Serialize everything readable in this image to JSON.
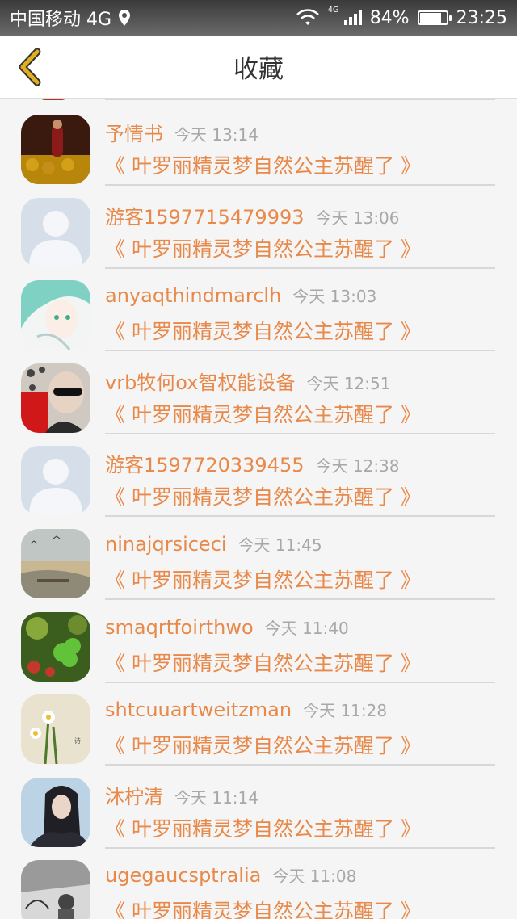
{
  "status_bar": {
    "carrier": "中国移动 4G",
    "network_small": "4G",
    "battery": "84%",
    "battery_level": 0.84,
    "time": "23:25"
  },
  "header": {
    "title": "收藏",
    "back_icon": "chevron-left-icon"
  },
  "colors": {
    "accent": "#e8894a",
    "back_icon": "#e0b020",
    "time_text": "#a8a8a8"
  },
  "items": [
    {
      "name": "予情书",
      "time": "今天 13:14",
      "subject": "《 叶罗丽精灵梦自然公主苏醒了 》",
      "avatar": "monk-photo"
    },
    {
      "name": "游客1597715479993",
      "time": "今天 13:06",
      "subject": "《 叶罗丽精灵梦自然公主苏醒了 》",
      "avatar": "default-person"
    },
    {
      "name": "anyaqthindmarclh",
      "time": "今天 13:03",
      "subject": "《 叶罗丽精灵梦自然公主苏醒了 》",
      "avatar": "anime-girl"
    },
    {
      "name": "vrb牧何ox智权能设备",
      "time": "今天 12:51",
      "subject": "《 叶罗丽精灵梦自然公主苏醒了 》",
      "avatar": "sunglasses-photo"
    },
    {
      "name": "游客1597720339455",
      "time": "今天 12:38",
      "subject": "《 叶罗丽精灵梦自然公主苏醒了 》",
      "avatar": "default-person"
    },
    {
      "name": "ninajqrsiceci",
      "time": "今天 11:45",
      "subject": "《 叶罗丽精灵梦自然公主苏醒了 》",
      "avatar": "landscape"
    },
    {
      "name": "smaqrtfoirthwo",
      "time": "今天 11:40",
      "subject": "《 叶罗丽精灵梦自然公主苏醒了 》",
      "avatar": "clover"
    },
    {
      "name": "shtcuuartweitzman",
      "time": "今天 11:28",
      "subject": "《 叶罗丽精灵梦自然公主苏醒了 》",
      "avatar": "flowers"
    },
    {
      "name": "沐柠清",
      "time": "今天 11:14",
      "subject": "《 叶罗丽精灵梦自然公主苏醒了 》",
      "avatar": "girl-photo"
    },
    {
      "name": "ugegaucsptralia",
      "time": "今天 11:08",
      "subject": "《 叶罗丽精灵梦自然公主苏醒了 》",
      "avatar": "bw-photo"
    }
  ]
}
